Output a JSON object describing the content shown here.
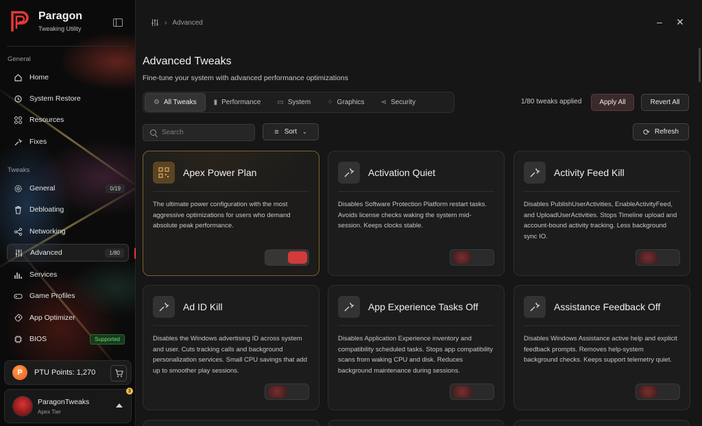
{
  "brand": {
    "name": "Paragon",
    "subtitle": "Tweaking Utility"
  },
  "sidebar": {
    "general_label": "General",
    "general_items": [
      {
        "label": "Home",
        "icon": "home-icon"
      },
      {
        "label": "System Restore",
        "icon": "restore-icon"
      },
      {
        "label": "Resources",
        "icon": "resources-icon"
      },
      {
        "label": "Fixes",
        "icon": "wrench-icon"
      }
    ],
    "tweaks_label": "Tweaks",
    "tweak_items": [
      {
        "label": "General",
        "icon": "gear-icon",
        "badge": "0/19"
      },
      {
        "label": "Debloating",
        "icon": "trash-icon"
      },
      {
        "label": "Networking",
        "icon": "network-icon"
      },
      {
        "label": "Advanced",
        "icon": "sliders-icon",
        "badge": "1/80",
        "active": true
      },
      {
        "label": "Services",
        "icon": "chart-icon"
      },
      {
        "label": "Game Profiles",
        "icon": "gamepad-icon"
      },
      {
        "label": "App Optimizer",
        "icon": "rocket-icon"
      },
      {
        "label": "BIOS",
        "icon": "chip-icon",
        "badge": "Supported"
      }
    ],
    "points": {
      "label": "PTU Points: 1,270",
      "coin": "P"
    },
    "user": {
      "name": "ParagonTweaks",
      "tier": "Apex Tier",
      "notifications": "3"
    }
  },
  "header": {
    "breadcrumb": "Advanced"
  },
  "page": {
    "title": "Advanced Tweaks",
    "subtitle": "Fine-tune your system with advanced performance optimizations"
  },
  "tabs": [
    {
      "label": "All Tweaks",
      "icon": "gear-icon",
      "active": true
    },
    {
      "label": "Performance",
      "icon": "bar-chart-icon"
    },
    {
      "label": "System",
      "icon": "monitor-icon"
    },
    {
      "label": "Graphics",
      "icon": "grid-icon"
    },
    {
      "label": "Security",
      "icon": "share-icon"
    }
  ],
  "toolbar": {
    "applied": "1/80 tweaks applied",
    "apply_all": "Apply All",
    "revert_all": "Revert All",
    "search_placeholder": "Search",
    "sort": "Sort",
    "refresh": "Refresh"
  },
  "cards": [
    {
      "name": "Apex Power Plan",
      "icon": "qr-icon",
      "enabled": true,
      "highlight": true,
      "description": "The ultimate power configuration with the most aggressive optimizations for users who demand absolute peak performance."
    },
    {
      "name": "Activation Quiet",
      "icon": "wrench-icon",
      "enabled": false,
      "description": "Disables Software Protection Platform restart tasks. Avoids license checks waking the system mid-session. Keeps clocks stable."
    },
    {
      "name": "Activity Feed Kill",
      "icon": "wrench-icon",
      "enabled": false,
      "description": "Disables PublishUserActivities, EnableActivityFeed, and UploadUserActivities. Stops Timeline upload and account-bound activity tracking. Less background sync IO."
    },
    {
      "name": "Ad ID Kill",
      "icon": "wrench-icon",
      "enabled": false,
      "description": "Disables the Windows advertising ID across system and user. Cuts tracking calls and background personalization services. Small CPU savings that add up to smoother play sessions."
    },
    {
      "name": "App Experience Tasks Off",
      "icon": "wrench-icon",
      "enabled": false,
      "description": "Disables Application Experience inventory and compatibility scheduled tasks. Stops app compatibility scans from waking CPU and disk. Reduces background maintenance during sessions."
    },
    {
      "name": "Assistance Feedback Off",
      "icon": "wrench-icon",
      "enabled": false,
      "description": "Disables Windows Assistance active help and explicit feedback prompts. Removes help-system background checks. Keeps support telemetry quiet."
    }
  ]
}
